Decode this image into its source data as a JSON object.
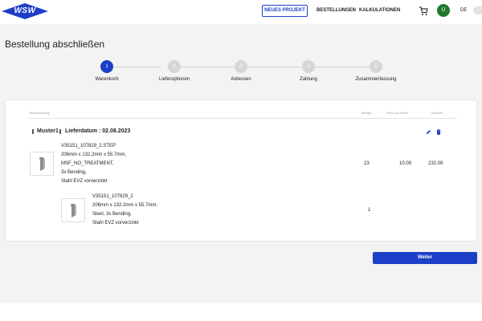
{
  "header": {
    "logo_text": "WSW",
    "new_project_label": "NEUES PROJEKT",
    "nav": [
      "BESTELLUNGEN",
      "KALKULATIONEN"
    ],
    "avatar_initial": "U",
    "language": "DE"
  },
  "page": {
    "title": "Bestellung abschließen"
  },
  "stepper": {
    "steps": [
      {
        "number": "1",
        "label": "Warenkorb"
      },
      {
        "number": "2",
        "label": "Lieferoptionen"
      },
      {
        "number": "3",
        "label": "Adressen"
      },
      {
        "number": "4",
        "label": "Zahlung"
      },
      {
        "number": "5",
        "label": "Zusammenfassung"
      }
    ],
    "active_step": 1
  },
  "table": {
    "headers": [
      "Beschreibung",
      "Menge",
      "Preis pro Stück",
      "Gesamt"
    ],
    "group": {
      "name": "Muster1",
      "delivery": "Lieferdatum : 02.08.2023"
    },
    "rows": [
      {
        "lines": [
          "V35151_107829_2.STEP",
          "206mm x 132.2mm x 55.7mm,",
          "MSF_NO_TREATMENT,",
          "3x Bending,",
          "Stahl EVZ vorverzinkt"
        ],
        "quantity": "23",
        "unit_price": "10.09",
        "total": "232.09"
      },
      {
        "lines": [
          "V35151_107829_2",
          "206mm x 132.2mm x 55.7mm,",
          "Steel, 3x Bending,",
          "Stahl EVZ vorverzinkt"
        ],
        "quantity": "1",
        "unit_price": "",
        "total": ""
      }
    ]
  },
  "actions": {
    "next_label": "Weiter"
  },
  "colors": {
    "primary": "#1d3fc8",
    "avatar": "#1f7a2b"
  }
}
